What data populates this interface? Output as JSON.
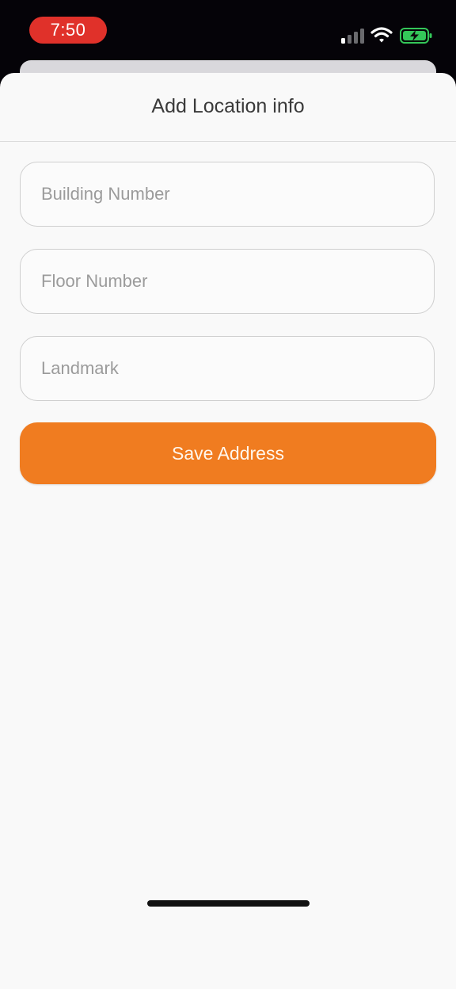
{
  "status_bar": {
    "time": "7:50",
    "signal_icon": "cellular-signal-icon",
    "wifi_icon": "wifi-icon",
    "battery_icon": "battery-charging-icon",
    "time_pill_color": "#e0312a",
    "battery_color": "#34c759"
  },
  "sheet": {
    "title": "Add Location info"
  },
  "form": {
    "building_number": {
      "placeholder": "Building Number",
      "value": ""
    },
    "floor_number": {
      "placeholder": "Floor Number",
      "value": ""
    },
    "landmark": {
      "placeholder": "Landmark",
      "value": ""
    },
    "save_label": "Save Address"
  },
  "colors": {
    "accent": "#f07c20",
    "background": "#f9f9f9",
    "placeholder": "#9b9b9b"
  }
}
